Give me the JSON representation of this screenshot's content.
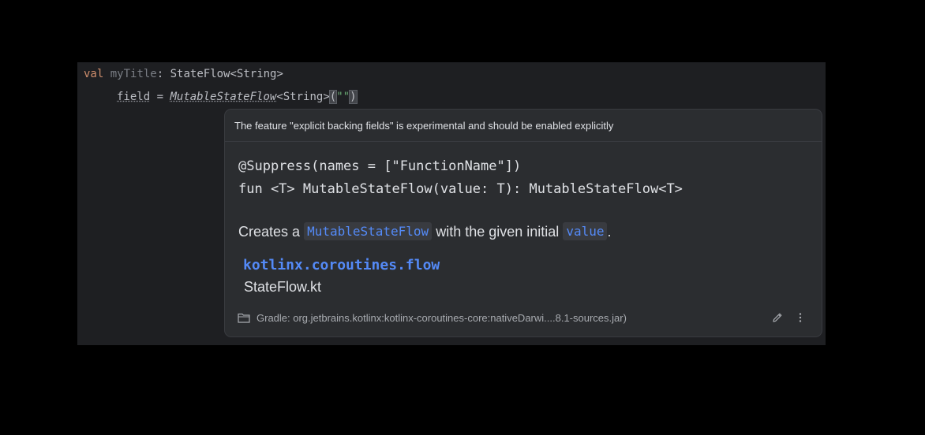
{
  "editor": {
    "line1": {
      "keyword": "val",
      "name": "myTitle",
      "colon": ":",
      "type": "StateFlow<String>"
    },
    "line2": {
      "field_keyword": "field",
      "equals": "=",
      "call": "MutableStateFlow",
      "generic": "<String>",
      "open_paren": "(",
      "string_literal": "\"\"",
      "close_paren": ")"
    }
  },
  "popup": {
    "warning": "The feature \"explicit backing fields\" is experimental and should be enabled explicitly",
    "signature_line1": "@Suppress(names = [\"FunctionName\"])",
    "signature_line2": "fun <T> MutableStateFlow(value: T): MutableStateFlow<T>",
    "description": {
      "prefix": "Creates a",
      "code1": "MutableStateFlow",
      "middle": "with the given initial",
      "code2": "value",
      "suffix": "."
    },
    "package": "kotlinx.coroutines.flow",
    "file": "StateFlow.kt",
    "source": "Gradle: org.jetbrains.kotlinx:kotlinx-coroutines-core:nativeDarwi....8.1-sources.jar)"
  },
  "icons": {
    "source": "folder-icon",
    "edit": "pencil-icon",
    "more": "more-vertical-icon"
  },
  "colors": {
    "background": "#000000",
    "editor_bg": "#1e1f22",
    "popup_bg": "#2b2d30",
    "keyword": "#cf8e6d",
    "string": "#6aab73",
    "link": "#548af7"
  }
}
